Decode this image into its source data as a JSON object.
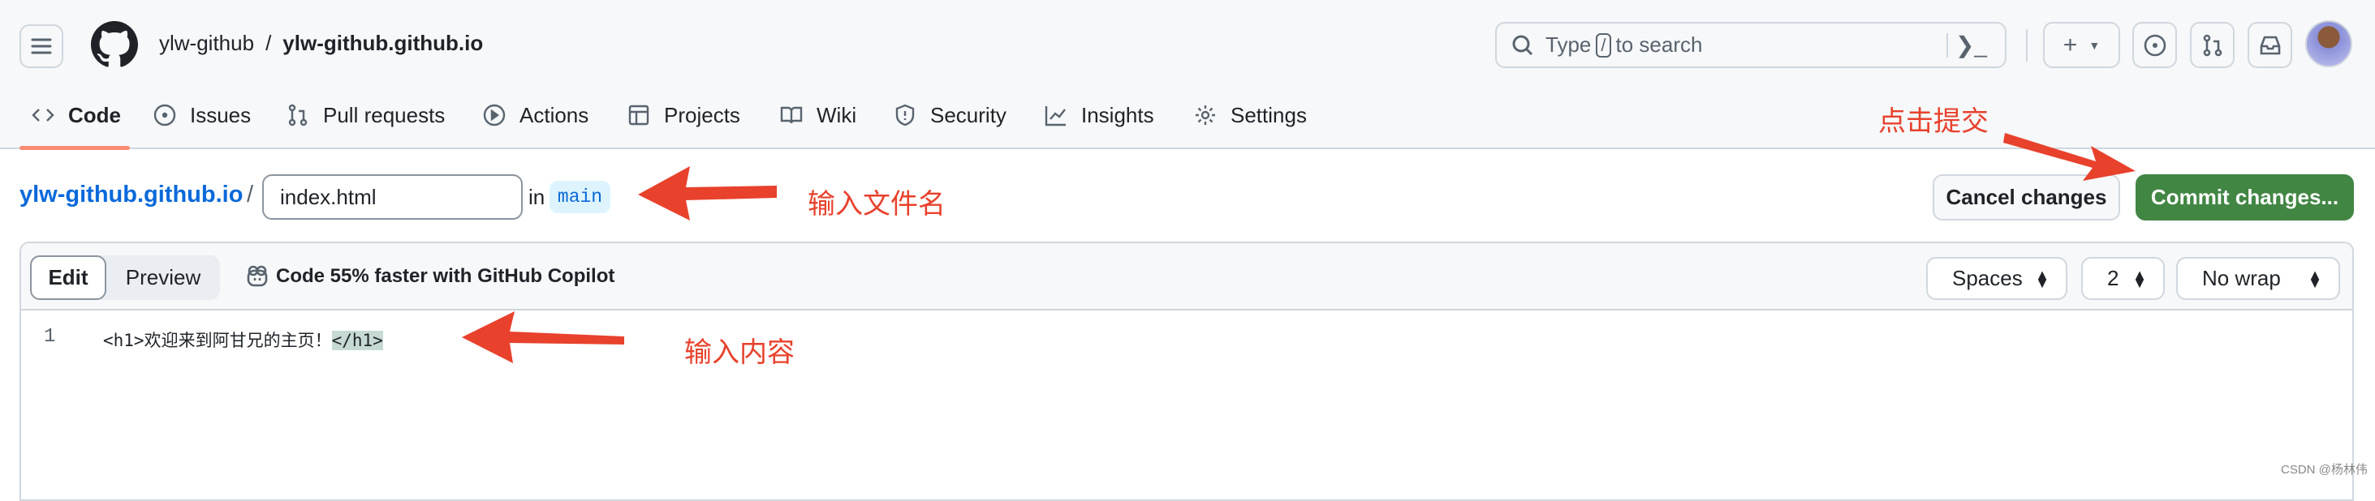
{
  "header": {
    "owner": "ylw-github",
    "separator": "/",
    "repo": "ylw-github.github.io",
    "search_prefix": "Type",
    "search_key": "/",
    "search_suffix": "to search"
  },
  "tabs": [
    {
      "label": "Code",
      "icon": "code-icon",
      "active": true
    },
    {
      "label": "Issues",
      "icon": "issue-icon"
    },
    {
      "label": "Pull requests",
      "icon": "pull-request-icon"
    },
    {
      "label": "Actions",
      "icon": "play-icon"
    },
    {
      "label": "Projects",
      "icon": "table-icon"
    },
    {
      "label": "Wiki",
      "icon": "book-icon"
    },
    {
      "label": "Security",
      "icon": "shield-icon"
    },
    {
      "label": "Insights",
      "icon": "graph-icon"
    },
    {
      "label": "Settings",
      "icon": "gear-icon"
    }
  ],
  "path": {
    "repo": "ylw-github.github.io",
    "separator": "/",
    "filename": "index.html",
    "in": "in",
    "branch": "main"
  },
  "actions": {
    "cancel": "Cancel changes",
    "commit": "Commit changes..."
  },
  "editor": {
    "edit": "Edit",
    "preview": "Preview",
    "copilot": "Code 55% faster with GitHub Copilot",
    "indent_mode": "Spaces",
    "indent_size": "2",
    "wrap_mode": "No wrap",
    "lines": [
      {
        "number": "1",
        "code_open": "<h1>欢迎来到阿甘兄的主页！",
        "code_close": "</h1>"
      }
    ]
  },
  "annotations": {
    "filename": "输入文件名",
    "content": "输入内容",
    "commit": "点击提交"
  },
  "watermark": "CSDN @杨林伟",
  "colors": {
    "accent": "#fd8c73",
    "link": "#0969da",
    "commit": "#428644",
    "annotation": "#e8412c"
  }
}
